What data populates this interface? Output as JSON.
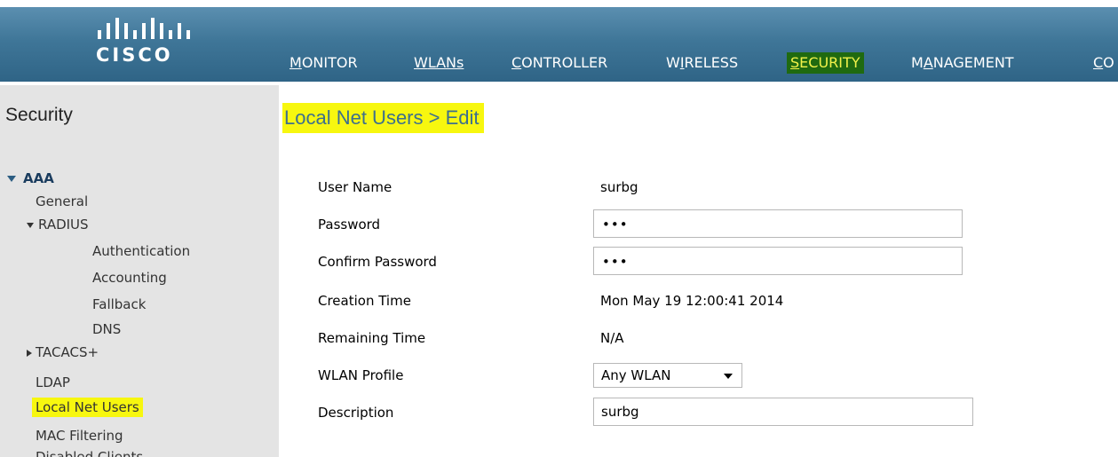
{
  "header": {
    "logo_text": "CISCO",
    "nav": [
      {
        "label": "MONITOR",
        "mnemonic": "M",
        "rest": "ONITOR"
      },
      {
        "label": "WLANs",
        "mnemonic": "W",
        "rest": "LANs"
      },
      {
        "label": "CONTROLLER",
        "mnemonic": "C",
        "rest": "ONTROLLER"
      },
      {
        "label": "WIRELESS",
        "pre": "W",
        "mnemonic": "I",
        "rest": "RELESS"
      },
      {
        "label": "SECURITY",
        "mnemonic": "S",
        "rest": "ECURITY"
      },
      {
        "label": "MANAGEMENT",
        "pre": "M",
        "mnemonic": "A",
        "rest": "NAGEMENT"
      },
      {
        "label": "CO",
        "mnemonic": "C",
        "rest": "O"
      }
    ],
    "active_nav": "SECURITY"
  },
  "sidebar": {
    "title": "Security",
    "aaa": "AAA",
    "general": "General",
    "radius": "RADIUS",
    "authentication": "Authentication",
    "accounting": "Accounting",
    "fallback": "Fallback",
    "dns": "DNS",
    "tacacs": "TACACS+",
    "ldap": "LDAP",
    "local_net_users": "Local Net Users",
    "mac_filtering": "MAC Filtering",
    "disabled_clients": "Disabled Clients"
  },
  "main": {
    "title": "Local Net Users > Edit",
    "fields": {
      "user_name_label": "User Name",
      "user_name_value": "surbg",
      "password_label": "Password",
      "password_value": "•••",
      "confirm_password_label": "Confirm Password",
      "confirm_password_value": "•••",
      "creation_time_label": "Creation Time",
      "creation_time_value": "Mon May 19 12:00:41 2014",
      "remaining_time_label": "Remaining Time",
      "remaining_time_value": "N/A",
      "wlan_profile_label": "WLAN Profile",
      "wlan_profile_value": "Any WLAN",
      "description_label": "Description",
      "description_value": "surbg"
    }
  },
  "colors": {
    "header_blue": "#3f7698",
    "active_tab_bg": "#1f6a10",
    "active_tab_text": "#f2f24a",
    "active_underline": "#f08c1c",
    "highlight": "#f7f70f",
    "sidebar_bg": "#e4e4e4",
    "title_text": "#3d6f8e"
  }
}
